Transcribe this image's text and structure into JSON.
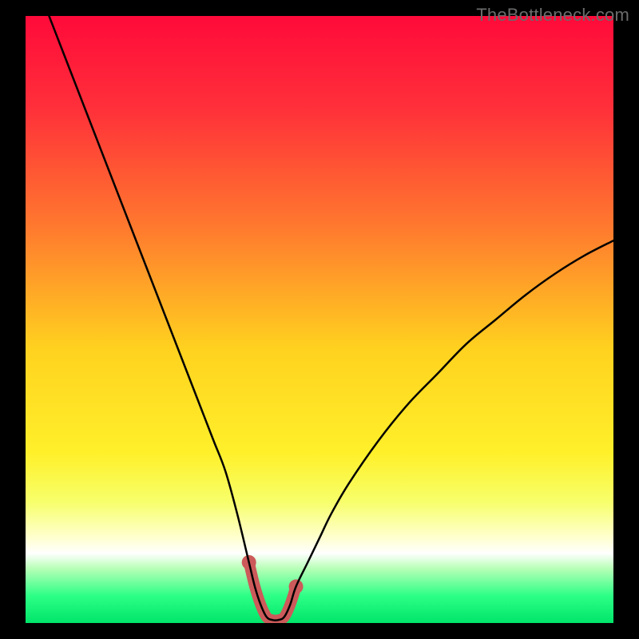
{
  "watermark": "TheBottleneck.com",
  "chart_data": {
    "type": "line",
    "title": "",
    "xlabel": "",
    "ylabel": "",
    "xlim": [
      0,
      100
    ],
    "ylim": [
      0,
      100
    ],
    "gradient_stops": [
      {
        "offset": 0.0,
        "color": "#ff0a3a"
      },
      {
        "offset": 0.15,
        "color": "#ff2f3a"
      },
      {
        "offset": 0.35,
        "color": "#ff7a2e"
      },
      {
        "offset": 0.55,
        "color": "#ffd21f"
      },
      {
        "offset": 0.72,
        "color": "#fff02a"
      },
      {
        "offset": 0.8,
        "color": "#f7ff6a"
      },
      {
        "offset": 0.86,
        "color": "#ffffd0"
      },
      {
        "offset": 0.885,
        "color": "#ffffff"
      },
      {
        "offset": 0.91,
        "color": "#b8ffb8"
      },
      {
        "offset": 0.955,
        "color": "#2dff86"
      },
      {
        "offset": 1.0,
        "color": "#00e56a"
      }
    ],
    "series": [
      {
        "name": "bottleneck-curve",
        "color": "#000000",
        "stroke_width": 2.5,
        "x": [
          4,
          6,
          8,
          10,
          12,
          14,
          16,
          18,
          20,
          22,
          24,
          26,
          28,
          30,
          32,
          34,
          36,
          38,
          39,
          40,
          41,
          42,
          43,
          44,
          45,
          46,
          48,
          50,
          52,
          55,
          60,
          65,
          70,
          75,
          80,
          85,
          90,
          95,
          100
        ],
        "y": [
          100,
          95,
          90,
          85,
          80,
          75,
          70,
          65,
          60,
          55,
          50,
          45,
          40,
          35,
          30,
          25,
          18,
          10,
          6,
          3,
          1,
          0.5,
          0.5,
          1,
          3,
          6,
          10,
          14,
          18,
          23,
          30,
          36,
          41,
          46,
          50,
          54,
          57.5,
          60.5,
          63
        ]
      },
      {
        "name": "highlight-band",
        "color": "#cc5a5a",
        "stroke_width": 14,
        "x": [
          38,
          39,
          40,
          41,
          42,
          43,
          44,
          45,
          46
        ],
        "y": [
          10,
          6,
          3,
          1,
          0.5,
          0.5,
          1,
          3,
          6
        ]
      }
    ],
    "highlight_endpoints": {
      "left": {
        "x": 38,
        "y": 10
      },
      "right": {
        "x": 46,
        "y": 6
      }
    }
  }
}
